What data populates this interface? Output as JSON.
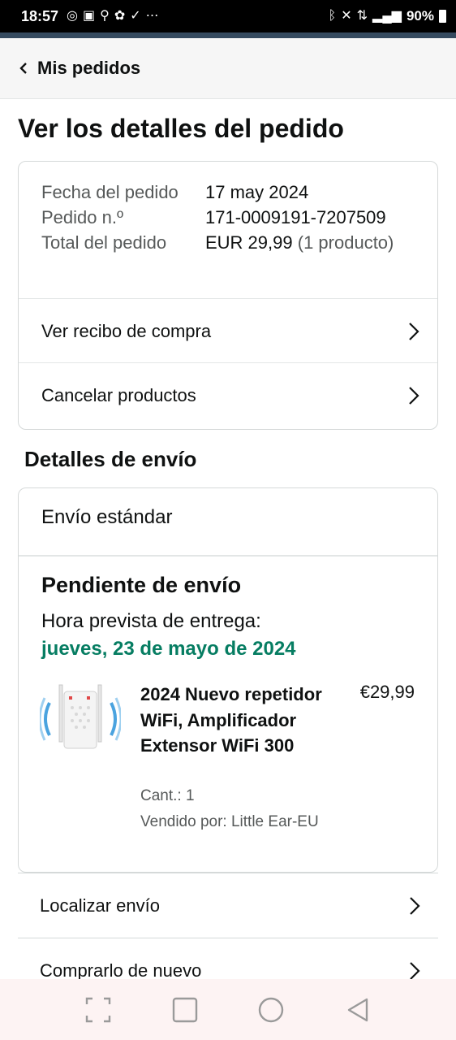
{
  "status_bar": {
    "time": "18:57",
    "battery": "90%",
    "left_icons": [
      "whatsapp-icon",
      "gallery-icon",
      "location-icon",
      "app-icon",
      "nike-icon",
      "more-icon"
    ],
    "right_icons": [
      "bluetooth-icon",
      "mute-icon",
      "data-icon",
      "signal-icon",
      "battery-icon"
    ]
  },
  "header": {
    "back_label": "Mis pedidos"
  },
  "page_title": "Ver los detalles del pedido",
  "summary": {
    "rows": [
      {
        "key": "Fecha del pedido",
        "value": "17 may 2024",
        "extra": ""
      },
      {
        "key": "Pedido n.º",
        "value": "171-0009191-7207509",
        "extra": ""
      },
      {
        "key": "Total del pedido",
        "value": "EUR 29,99",
        "extra": "(1 producto)"
      }
    ],
    "links": [
      "Ver recibo de compra",
      "Cancelar productos"
    ]
  },
  "shipping": {
    "section_title": "Detalles de envío",
    "method": "Envío estándar",
    "status": "Pendiente de envío",
    "eta_label": "Hora prevista de entrega:",
    "eta_date": "jueves, 23 de mayo de 2024",
    "item": {
      "title": "2024 Nuevo repetidor WiFi, Amplificador Extensor WiFi 300",
      "price": "€29,99",
      "qty": "Cant.: 1",
      "seller": "Vendido por: Little Ear-EU"
    }
  },
  "actions": [
    "Localizar envío",
    "Comprarlo de nuevo"
  ],
  "colors": {
    "eta_green": "#067d62",
    "border": "#d5d9d9",
    "header_bg": "#f6f6f6",
    "nav_bg": "#fdf3f3"
  }
}
